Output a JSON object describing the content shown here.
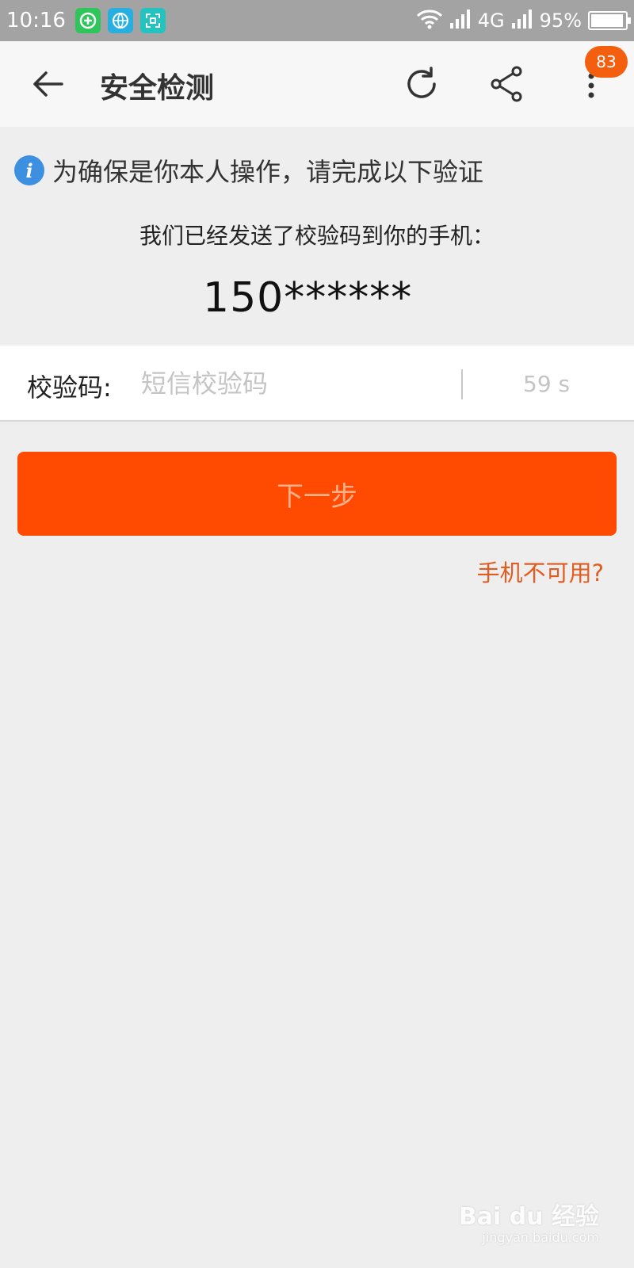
{
  "status_bar": {
    "time": "10:16",
    "network": "4G",
    "battery": "95%",
    "battery_level": 0.95,
    "app_icons": [
      {
        "icon": "plus-circle-icon",
        "color": "#2ec55a"
      },
      {
        "icon": "basketball-icon",
        "color": "#29aee0"
      },
      {
        "icon": "scan-icon",
        "color": "#23c4c0"
      }
    ]
  },
  "toolbar": {
    "title": "安全检测",
    "badge_count": "83"
  },
  "verify": {
    "notice": "为确保是你本人操作，请完成以下验证",
    "sent_text": "我们已经发送了校验码到你的手机：",
    "phone": "150******",
    "code_label": "校验码:",
    "code_placeholder": "短信校验码",
    "code_value": "",
    "countdown": "59 s",
    "next_label": "下一步",
    "unavailable_link": "手机不可用?"
  },
  "watermark": {
    "brand": "Bai du 经验",
    "url": "jingyan.baidu.com"
  },
  "colors": {
    "accent": "#ff4a02",
    "link": "#e35b1e",
    "info": "#3d8fe0",
    "badge": "#f45f0f"
  }
}
